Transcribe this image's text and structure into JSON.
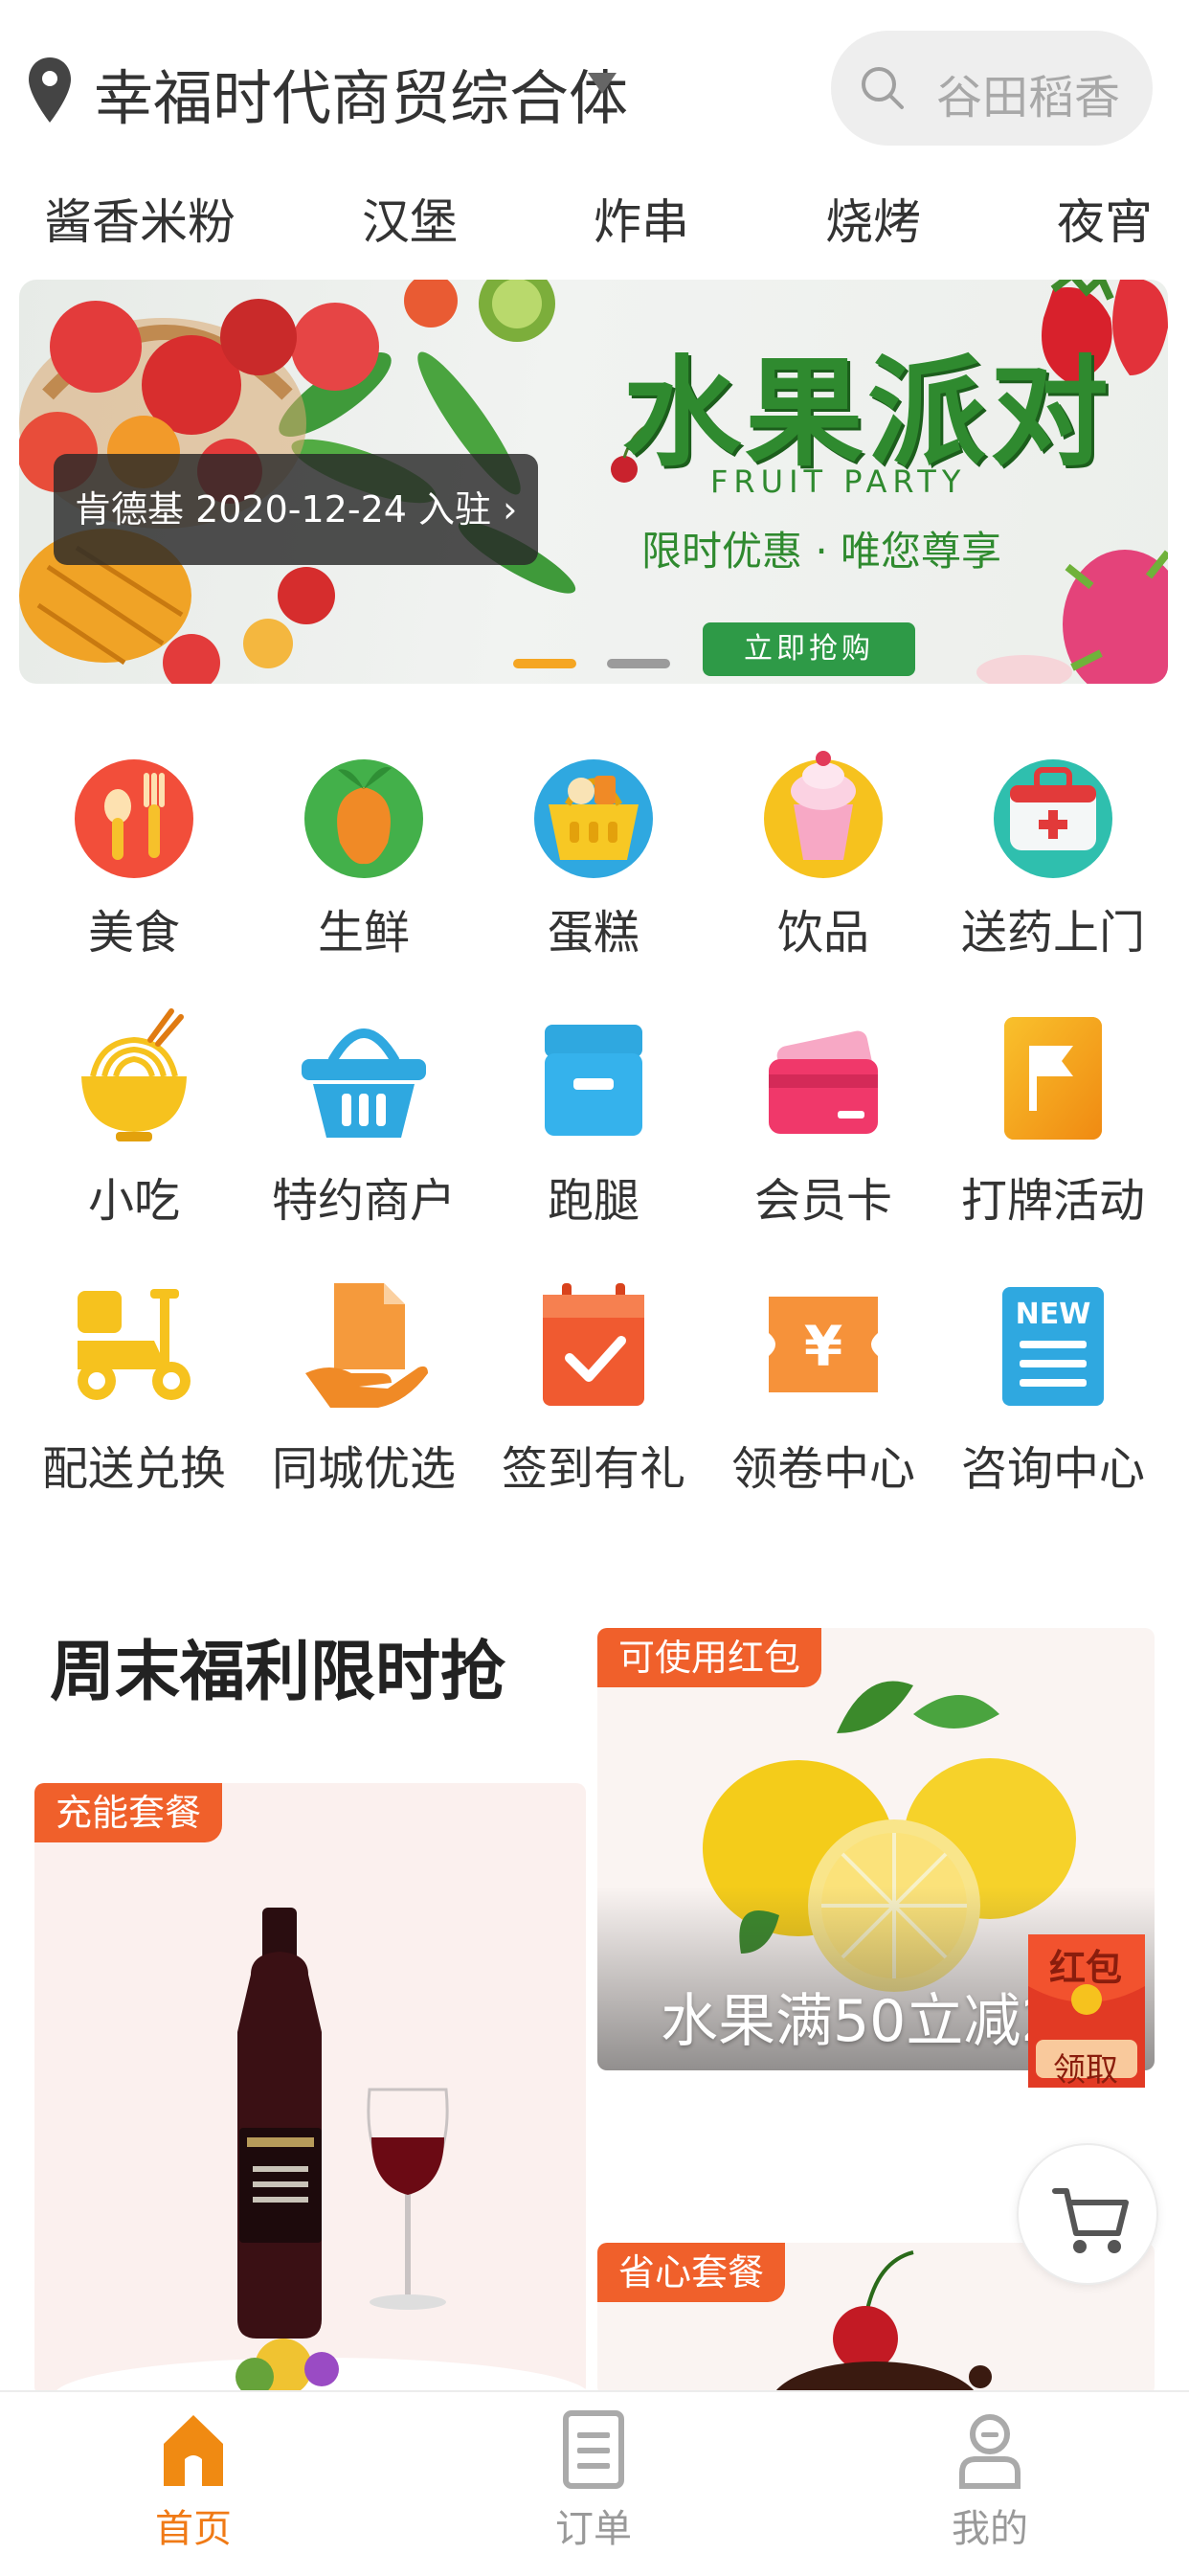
{
  "header": {
    "location": "幸福时代商贸综合体",
    "search_placeholder": "谷田稻香"
  },
  "categories": [
    "酱香米粉",
    "汉堡",
    "炸串",
    "烧烤",
    "夜宵"
  ],
  "banner": {
    "title": "水果派对",
    "subtitle": "FRUIT PARTY",
    "slogan": "限时优惠 · 唯您尊享",
    "button": "立即抢购",
    "notice": "肯德基 2020-12-24 入驻 ›",
    "active_page": 1,
    "page_count": 2
  },
  "grid": [
    {
      "label": "美食",
      "icon": "food-icon"
    },
    {
      "label": "生鲜",
      "icon": "fresh-icon"
    },
    {
      "label": "蛋糕",
      "icon": "cake-icon"
    },
    {
      "label": "饮品",
      "icon": "drink-icon"
    },
    {
      "label": "送药上门",
      "icon": "medicine-icon"
    },
    {
      "label": "小吃",
      "icon": "snack-icon"
    },
    {
      "label": "特约商户",
      "icon": "basket-icon"
    },
    {
      "label": "跑腿",
      "icon": "errand-box-icon"
    },
    {
      "label": "会员卡",
      "icon": "member-card-icon"
    },
    {
      "label": "打牌活动",
      "icon": "flag-icon"
    },
    {
      "label": "配送兑换",
      "icon": "scooter-icon"
    },
    {
      "label": "同城优选",
      "icon": "hand-document-icon"
    },
    {
      "label": "签到有礼",
      "icon": "calendar-check-icon"
    },
    {
      "label": "领卷中心",
      "icon": "coupon-icon"
    },
    {
      "label": "咨询中心",
      "icon": "news-icon"
    }
  ],
  "promo": {
    "title": "周末福利限时抢",
    "cards": [
      {
        "tag": "充能套餐"
      },
      {
        "tag": "可使用红包",
        "caption": "水果满50立减2"
      },
      {
        "tag": "省心套餐"
      }
    ]
  },
  "floating": {
    "red_packet_top": "红包",
    "red_packet_bottom": "领取"
  },
  "bottom_nav": [
    {
      "label": "首页",
      "icon": "home-icon",
      "active": true
    },
    {
      "label": "订单",
      "icon": "order-icon",
      "active": false
    },
    {
      "label": "我的",
      "icon": "profile-icon",
      "active": false
    }
  ],
  "colors": {
    "accent": "#f07a16",
    "tag": "#f0602b",
    "banner_green": "#2f8a2f"
  }
}
